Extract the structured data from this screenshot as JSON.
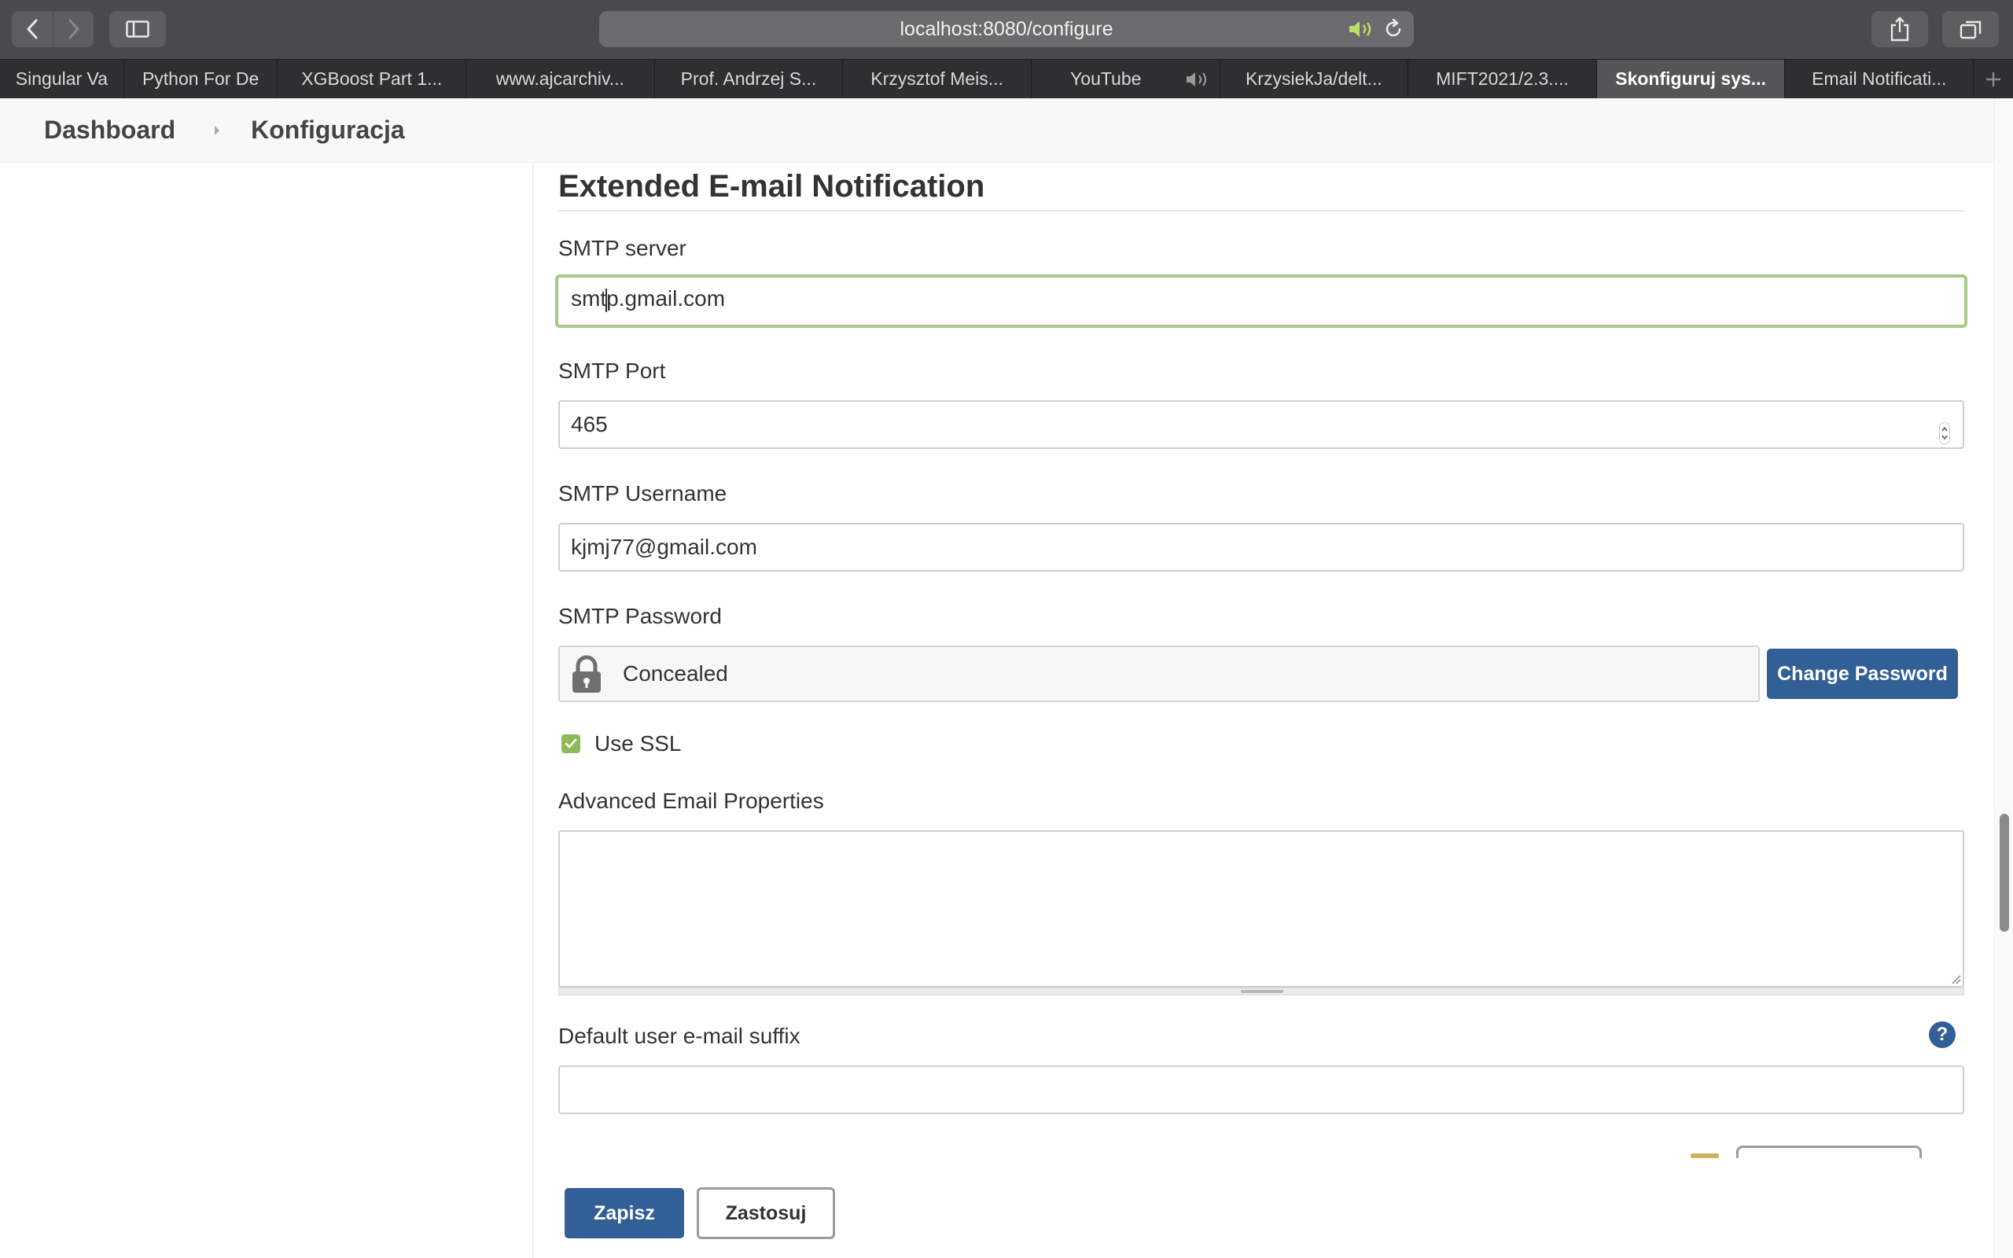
{
  "browser": {
    "url": "localhost:8080/configure",
    "tabs": [
      {
        "label": "Singular Va",
        "active": false
      },
      {
        "label": "Python For De",
        "active": false
      },
      {
        "label": "XGBoost Part 1...",
        "active": false
      },
      {
        "label": "www.ajcarchiv...",
        "active": false
      },
      {
        "label": "Prof. Andrzej S...",
        "active": false
      },
      {
        "label": "Krzysztof Meis...",
        "active": false
      },
      {
        "label": "YouTube",
        "active": false
      },
      {
        "label": "KrzysiekJa/delt...",
        "active": false
      },
      {
        "label": "MIFT2021/2.3....",
        "active": false
      },
      {
        "label": "Skonfiguruj sys...",
        "active": true
      },
      {
        "label": "Email Notificati...",
        "active": false
      }
    ]
  },
  "breadcrumb": {
    "dashboard": "Dashboard",
    "current": "Konfiguracja"
  },
  "form": {
    "section_title": "Extended E-mail Notification",
    "smtp_server": {
      "label": "SMTP server",
      "value_before_caret": "smt",
      "value_after_caret": "p.gmail.com"
    },
    "smtp_port": {
      "label": "SMTP Port",
      "value": "465"
    },
    "smtp_username": {
      "label": "SMTP Username",
      "value": "kjmj77@gmail.com"
    },
    "smtp_password": {
      "label": "SMTP Password",
      "value": "Concealed",
      "change_button": "Change Password"
    },
    "use_ssl": {
      "label": "Use SSL",
      "checked": true
    },
    "advanced_props": {
      "label": "Advanced Email Properties",
      "value": ""
    },
    "default_suffix": {
      "label": "Default user e-mail suffix",
      "value": "",
      "help": "?"
    }
  },
  "actions": {
    "save": "Zapisz",
    "apply": "Zastosuj"
  },
  "colors": {
    "primary": "#335f97",
    "focus_border": "#a6ca8a",
    "checkbox": "#8dbb5a",
    "speaker_active": "#b9dd6a"
  }
}
